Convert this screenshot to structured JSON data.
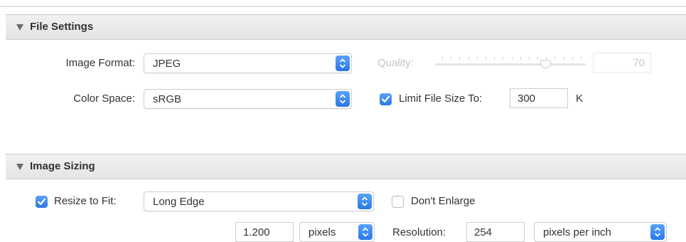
{
  "file_settings": {
    "title": "File Settings",
    "image_format": {
      "label": "Image Format:",
      "value": "JPEG"
    },
    "quality": {
      "label": "Quality:",
      "value": "70",
      "level": 0.7
    },
    "color_space": {
      "label": "Color Space:",
      "value": "sRGB"
    },
    "limit_file_size": {
      "checked": true,
      "label": "Limit File Size To:",
      "value": "300",
      "unit": "K"
    }
  },
  "image_sizing": {
    "title": "Image Sizing",
    "resize_to_fit": {
      "checked": true,
      "label": "Resize to Fit:",
      "value": "Long Edge"
    },
    "dont_enlarge": {
      "checked": false,
      "label": "Don't Enlarge"
    },
    "size": {
      "value": "1.200",
      "unit": "pixels"
    },
    "resolution": {
      "label": "Resolution:",
      "value": "254",
      "unit": "pixels per inch"
    }
  },
  "colors": {
    "accent": "#3b8cf5",
    "header_bg": "#e9e9e9",
    "disabled_text": "#c4c4c4"
  },
  "icons": {
    "section_toggle": "disclosure-triangle-down",
    "popup_stepper": "up-down-chevrons",
    "checkbox": "checkmark"
  }
}
